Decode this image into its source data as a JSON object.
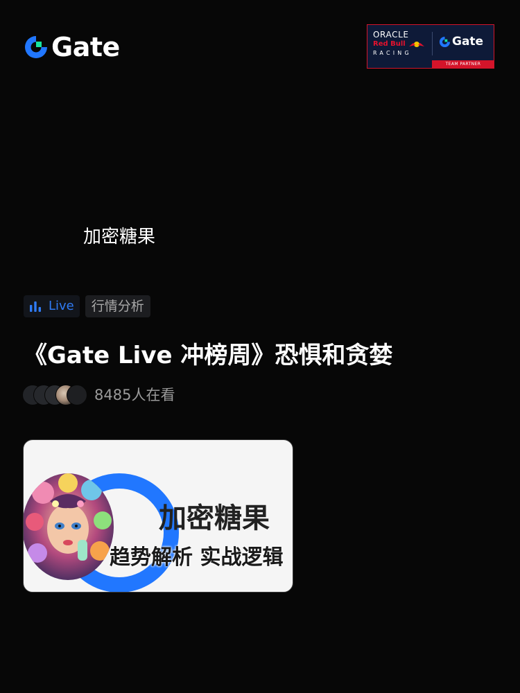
{
  "brand": {
    "logo_text": "Gate",
    "accent_color": "#2177ff",
    "logo_green": "#17e5a1"
  },
  "partner_badge": {
    "oracle": "ORACLE",
    "red_bull": "Red Bull",
    "racing": "RACING",
    "gate": "Gate",
    "strip": "TEAM PARTNER"
  },
  "stream": {
    "channel_name": "加密糖果",
    "live_label": "Live",
    "category": "行情分析",
    "title": "《Gate Live 冲榜周》恐惧和贪婪",
    "viewer_count": "8485人在看"
  },
  "thumbnail": {
    "title": "加密糖果",
    "subtitle": "趋势解析 实战逻辑"
  },
  "icons": {
    "logo": "gate-logo-icon",
    "live": "live-bars-icon",
    "bull": "red-bull-icon"
  }
}
